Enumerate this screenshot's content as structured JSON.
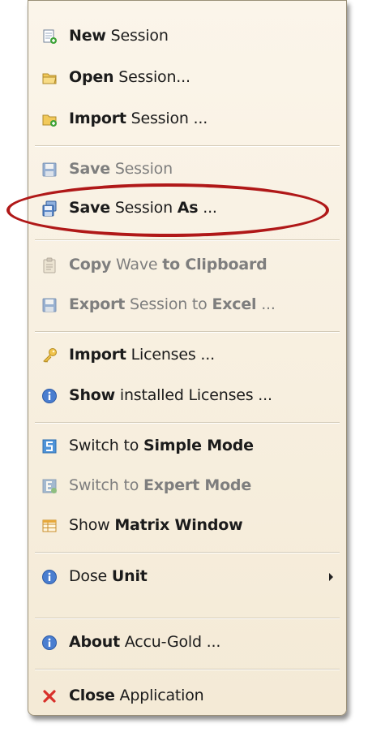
{
  "menu": {
    "items": [
      {
        "id": "new-session",
        "icon": "new-session-icon",
        "parts": [
          {
            "t": "New",
            "b": true
          },
          {
            "t": " Session",
            "b": false
          }
        ],
        "disabled": false
      },
      {
        "id": "open-session",
        "icon": "open-folder-icon",
        "parts": [
          {
            "t": "Open",
            "b": true
          },
          {
            "t": " Session...",
            "b": false
          }
        ],
        "disabled": false
      },
      {
        "id": "import-session",
        "icon": "import-session-icon",
        "parts": [
          {
            "t": "Import",
            "b": true
          },
          {
            "t": " Session ...",
            "b": false
          }
        ],
        "disabled": false
      },
      {
        "id": "save-session",
        "icon": "save-icon",
        "parts": [
          {
            "t": "Save",
            "b": true
          },
          {
            "t": " Session",
            "b": false
          }
        ],
        "disabled": true
      },
      {
        "id": "save-session-as",
        "icon": "save-as-icon",
        "parts": [
          {
            "t": "Save",
            "b": true
          },
          {
            "t": " Session ",
            "b": false
          },
          {
            "t": "As",
            "b": true
          },
          {
            "t": " ...",
            "b": false
          }
        ],
        "disabled": false
      },
      {
        "id": "copy-wave",
        "icon": "clipboard-icon",
        "parts": [
          {
            "t": "Copy",
            "b": true
          },
          {
            "t": " Wave ",
            "b": false
          },
          {
            "t": "to Clipboard",
            "b": true
          }
        ],
        "disabled": true
      },
      {
        "id": "export-excel",
        "icon": "save-icon",
        "parts": [
          {
            "t": "Export",
            "b": true
          },
          {
            "t": " Session to ",
            "b": false
          },
          {
            "t": "Excel",
            "b": true
          },
          {
            "t": " ...",
            "b": false
          }
        ],
        "disabled": true
      },
      {
        "id": "import-licenses",
        "icon": "key-icon",
        "parts": [
          {
            "t": "Import",
            "b": true
          },
          {
            "t": " Licenses ...",
            "b": false
          }
        ],
        "disabled": false
      },
      {
        "id": "show-licenses",
        "icon": "info-icon",
        "parts": [
          {
            "t": "Show",
            "b": true
          },
          {
            "t": " installed Licenses ...",
            "b": false
          }
        ],
        "disabled": false
      },
      {
        "id": "simple-mode",
        "icon": "simple-mode-icon",
        "parts": [
          {
            "t": "Switch to ",
            "b": false
          },
          {
            "t": "Simple Mode",
            "b": true
          }
        ],
        "disabled": false
      },
      {
        "id": "expert-mode",
        "icon": "expert-mode-icon",
        "parts": [
          {
            "t": "Switch to ",
            "b": false
          },
          {
            "t": "Expert Mode",
            "b": true
          }
        ],
        "disabled": true
      },
      {
        "id": "matrix-window",
        "icon": "matrix-window-icon",
        "parts": [
          {
            "t": "Show ",
            "b": false
          },
          {
            "t": "Matrix Window",
            "b": true
          }
        ],
        "disabled": false
      },
      {
        "id": "dose-unit",
        "icon": "info-icon",
        "parts": [
          {
            "t": "Dose ",
            "b": false
          },
          {
            "t": "Unit",
            "b": true
          }
        ],
        "disabled": false,
        "submenu": true
      },
      {
        "id": "about",
        "icon": "info-icon",
        "parts": [
          {
            "t": "About",
            "b": true
          },
          {
            "t": " Accu-Gold ...",
            "b": false
          }
        ],
        "disabled": false
      },
      {
        "id": "close-application",
        "icon": "close-x-icon",
        "parts": [
          {
            "t": "Close",
            "b": true
          },
          {
            "t": " Application",
            "b": false
          }
        ],
        "disabled": false
      }
    ]
  },
  "colors": {
    "menu_bg": "#f7efdf",
    "highlight_ellipse": "#b01818",
    "disabled_text": "#7e7e7e"
  }
}
